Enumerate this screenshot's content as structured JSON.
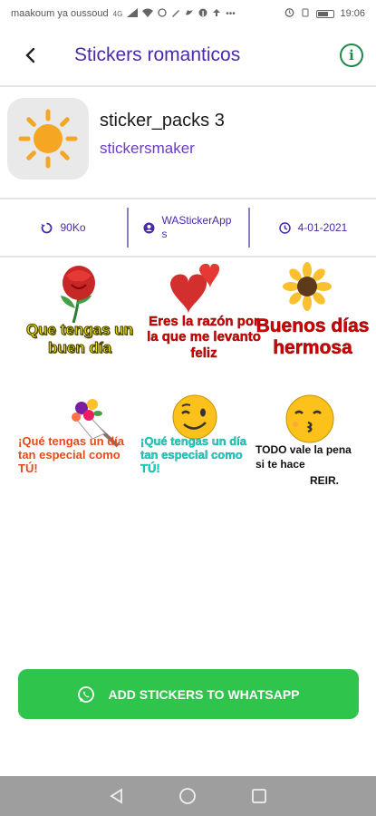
{
  "status_bar": {
    "carrier": "maakoum ya oussoud",
    "network": "4G",
    "time": "19:06"
  },
  "app_bar": {
    "title": "Stickers romanticos"
  },
  "pack": {
    "name": "sticker_packs 3",
    "author": "stickersmaker",
    "icon": "sun-icon"
  },
  "info": {
    "size": "90Ko",
    "publisher": "WAStickerApps",
    "date": "4-01-2021"
  },
  "stickers": [
    {
      "text": "Que tengas un buen día",
      "image": "rose-icon"
    },
    {
      "text": "Eres la razón por la que me levanto feliz",
      "image": "hearts-icon"
    },
    {
      "text": "Buenos días hermosa",
      "image": "sunflower-icon"
    },
    {
      "text": "¡Qué tengas un día tan especial como TÚ!",
      "image": "bouquet-icon"
    },
    {
      "text": "¡Qué tengas un día tan especial como TÚ!",
      "image": "wink-emoji-icon"
    },
    {
      "text_line1": "TODO vale la pena",
      "text_line2": "si te hace",
      "text_line3": "REIR.",
      "image": "kiss-emoji-icon"
    }
  ],
  "add_button": {
    "label": "ADD STICKERS TO WHATSAPP"
  },
  "colors": {
    "accent": "#4b2aa8",
    "button_green": "#2fc44b",
    "info_green": "#1e8a4a"
  }
}
